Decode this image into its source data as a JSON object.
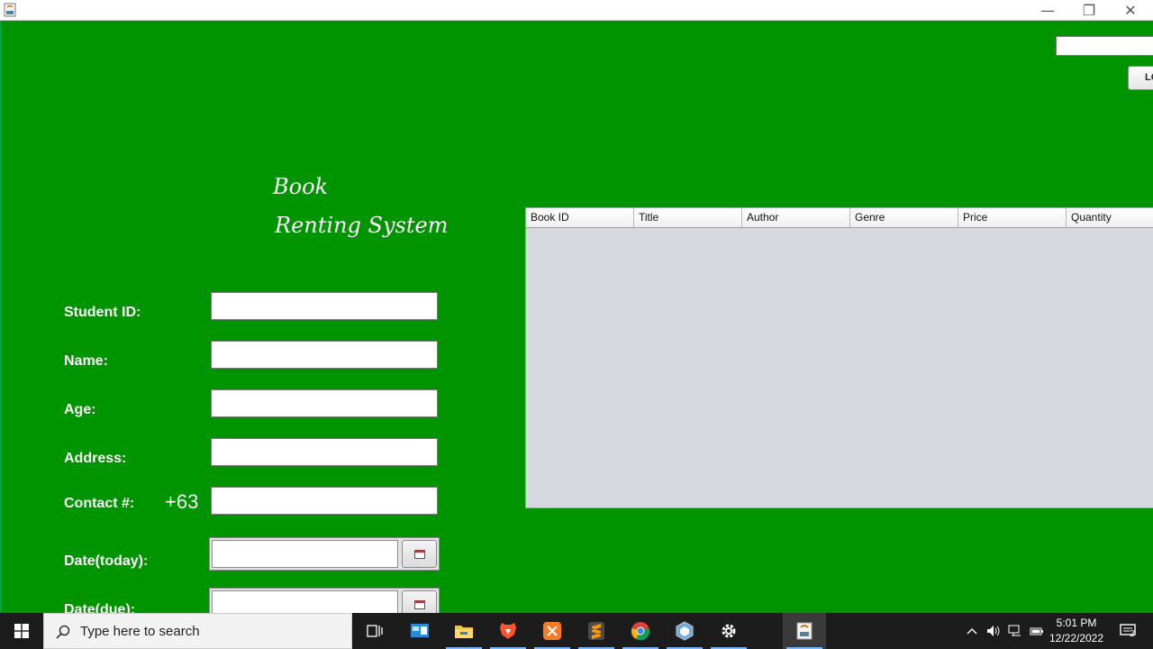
{
  "window": {
    "minimize": "—",
    "maximize": "❐",
    "close": "✕"
  },
  "header": {
    "login_label": "LO"
  },
  "app_title": {
    "line1": "Book",
    "line2": "Renting System"
  },
  "form": {
    "student_id_label": "Student ID:",
    "name_label": "Name:",
    "age_label": "Age:",
    "address_label": "Address:",
    "contact_label": "Contact #:",
    "contact_prefix": "+63",
    "date_today_label": "Date(today):",
    "date_due_label": "Date(due):"
  },
  "table": {
    "columns": [
      "Book ID",
      "Title",
      "Author",
      "Genre",
      "Price",
      "Quantity"
    ]
  },
  "taskbar": {
    "search_placeholder": "Type here to search",
    "time": "5:01 PM",
    "date": "12/22/2022",
    "notification_count": "2"
  },
  "colors": {
    "background": "#009400",
    "table_bg": "#d6d9e0"
  }
}
